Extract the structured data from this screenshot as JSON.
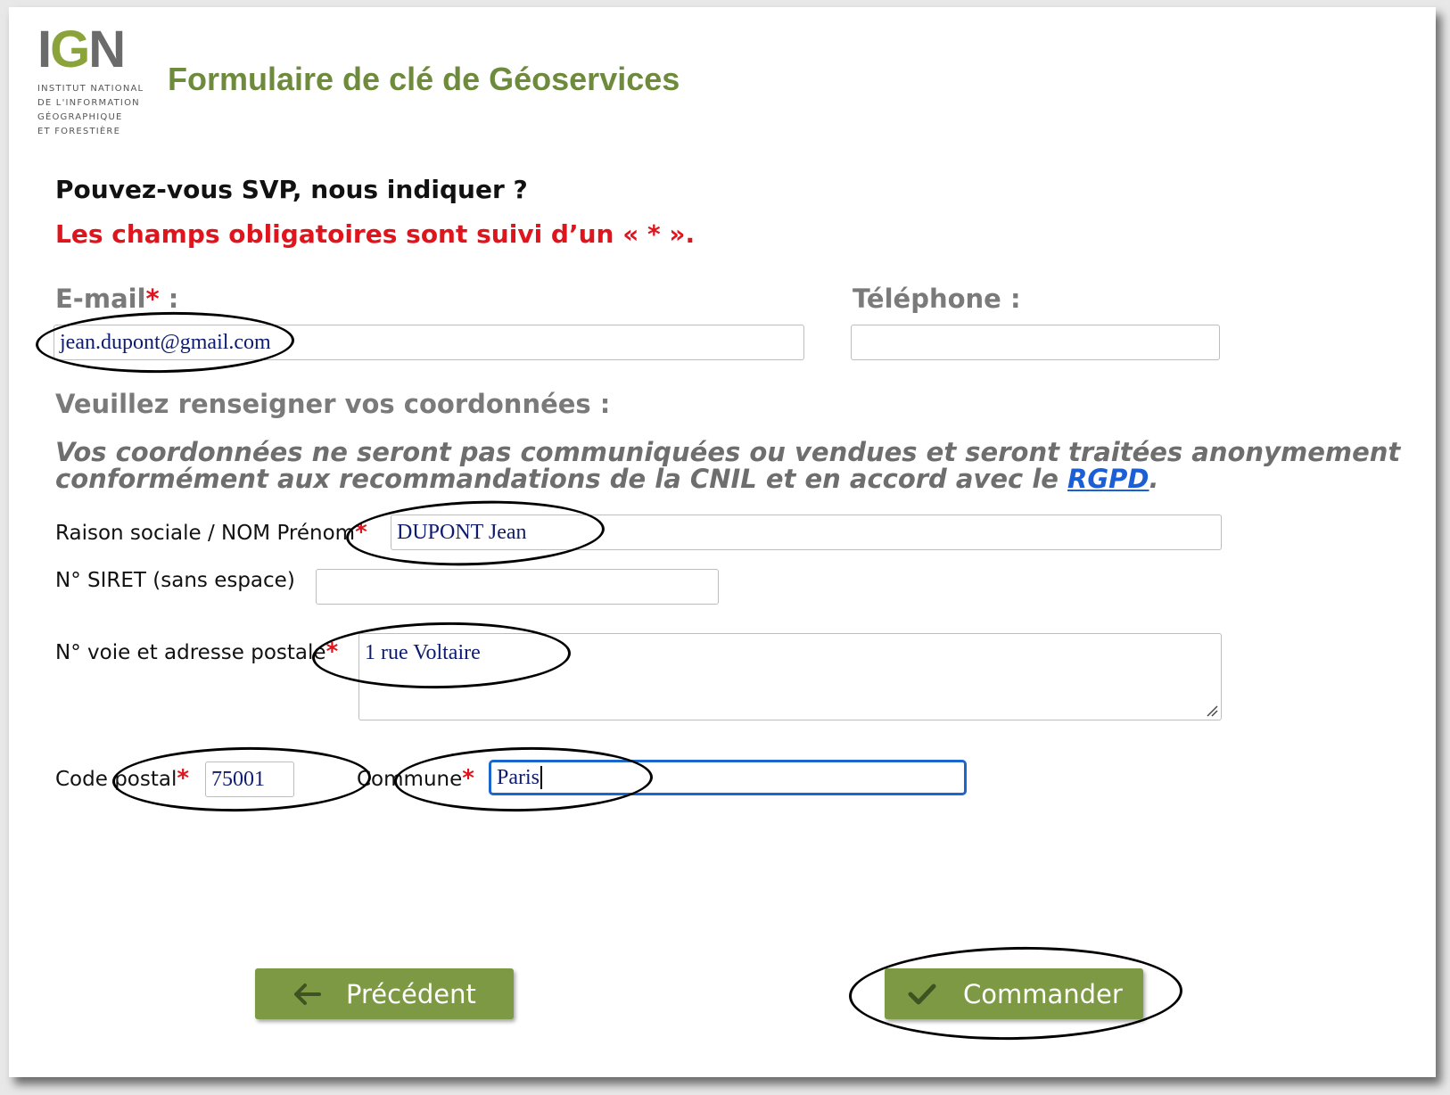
{
  "logo": {
    "mark": "IGN",
    "lines": [
      "INSTITUT NATIONAL",
      "DE L'INFORMATION",
      "GÉOGRAPHIQUE",
      "ET FORESTIÈRE"
    ]
  },
  "header": {
    "title": "Formulaire de clé de Géoservices"
  },
  "intro": {
    "question": "Pouvez-vous SVP, nous indiquer ?",
    "required_note": "Les champs obligatoires sont suivi d’un « * »."
  },
  "email": {
    "label": "E-mail",
    "star": "*",
    "colon": " :",
    "value": "jean.dupont@gmail.com"
  },
  "phone": {
    "label": "Téléphone :",
    "value": ""
  },
  "coordinates": {
    "heading": "Veuillez renseigner vos coordonnées :"
  },
  "privacy": {
    "text": "Vos coordonnées ne seront pas communiquées ou vendues et seront traitées anonymement conformément aux recommandations de la CNIL et en accord avec le ",
    "link": "RGPD",
    "end": "."
  },
  "fields": {
    "company": {
      "label": "Raison sociale / NOM Prénom",
      "star": "*",
      "value": "DUPONT Jean"
    },
    "siret": {
      "label": "N° SIRET (sans espace)",
      "value": ""
    },
    "address": {
      "label": "N° voie et adresse postale",
      "star": "*",
      "value": "1 rue Voltaire"
    },
    "postal_code": {
      "label": "Code postal",
      "star": "*",
      "value": "75001"
    },
    "city": {
      "label": "Commune",
      "star": "*",
      "value": "Paris"
    }
  },
  "buttons": {
    "previous": {
      "label": "Précédent",
      "icon": "arrow-left-icon"
    },
    "order": {
      "label": "Commander",
      "icon": "checkmark-icon"
    }
  },
  "colors": {
    "brand_green": "#6e8b3d",
    "button_green": "#7d9944",
    "required_red": "#e0141c",
    "link_blue": "#1a5fd6",
    "focus_blue": "#1a66cc"
  }
}
